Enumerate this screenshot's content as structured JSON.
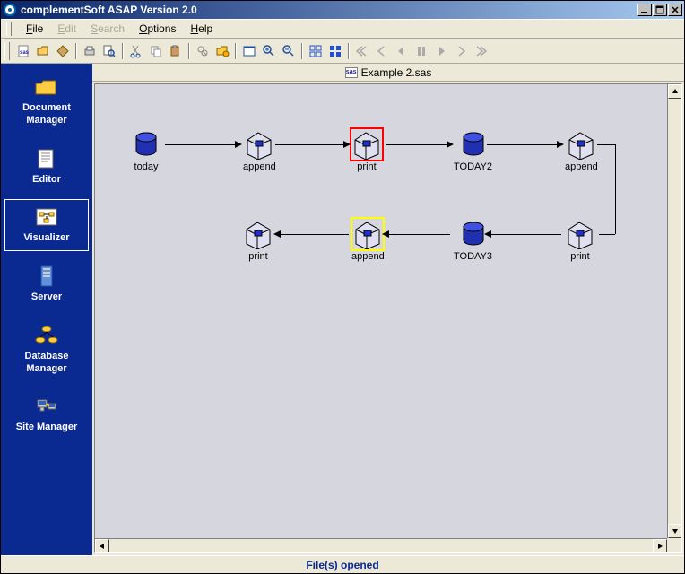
{
  "window": {
    "title": "complementSoft ASAP Version 2.0"
  },
  "menu": {
    "file": "File",
    "edit": "Edit",
    "search": "Search",
    "options": "Options",
    "help": "Help"
  },
  "sidebar": {
    "doc_mgr": "Document Manager",
    "editor": "Editor",
    "visualizer": "Visualizer",
    "server": "Server",
    "db_mgr": "Database Manager",
    "site_mgr": "Site Manager"
  },
  "doc_tab": {
    "icon_text": "sas",
    "filename": "Example 2.sas"
  },
  "nodes": {
    "row1": {
      "n1": "today",
      "n2": "append",
      "n3": "print",
      "n4": "TODAY2",
      "n5": "append"
    },
    "row2": {
      "n1": "print",
      "n2": "TODAY3",
      "n3": "append",
      "n4": "print"
    }
  },
  "status": "File(s) opened"
}
